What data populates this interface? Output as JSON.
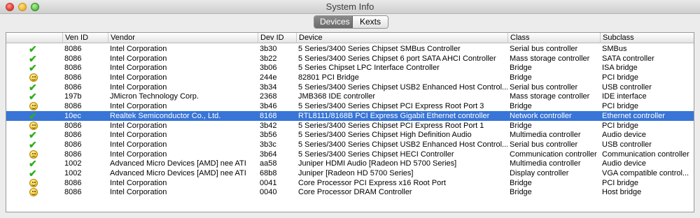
{
  "window": {
    "title": "System Info"
  },
  "tabs": [
    {
      "label": "Devices",
      "active": true
    },
    {
      "label": "Kexts",
      "active": false
    }
  ],
  "table": {
    "columns": [
      "",
      "Ven ID",
      "Vendor",
      "Dev ID",
      "Device",
      "Class",
      "Subclass"
    ],
    "rows": [
      {
        "status": "ok",
        "ven_id": "8086",
        "vendor": "Intel Corporation",
        "dev_id": "3b30",
        "device": "5 Series/3400 Series Chipset SMBus Controller",
        "class": "Serial bus controller",
        "subclass": "SMBus"
      },
      {
        "status": "ok",
        "ven_id": "8086",
        "vendor": "Intel Corporation",
        "dev_id": "3b22",
        "device": "5 Series/3400 Series Chipset 6 port SATA AHCI Controller",
        "class": "Mass storage controller",
        "subclass": "SATA controller"
      },
      {
        "status": "ok",
        "ven_id": "8086",
        "vendor": "Intel Corporation",
        "dev_id": "3b06",
        "device": "5 Series Chipset LPC Interface Controller",
        "class": "Bridge",
        "subclass": "ISA bridge"
      },
      {
        "status": "neutral",
        "ven_id": "8086",
        "vendor": "Intel Corporation",
        "dev_id": "244e",
        "device": "82801 PCI Bridge",
        "class": "Bridge",
        "subclass": "PCI bridge"
      },
      {
        "status": "ok",
        "ven_id": "8086",
        "vendor": "Intel Corporation",
        "dev_id": "3b34",
        "device": "5 Series/3400 Series Chipset USB2 Enhanced Host Control...",
        "class": "Serial bus controller",
        "subclass": "USB controller"
      },
      {
        "status": "ok",
        "ven_id": "197b",
        "vendor": "JMicron Technology Corp.",
        "dev_id": "2368",
        "device": "JMB368 IDE controller",
        "class": "Mass storage controller",
        "subclass": "IDE interface"
      },
      {
        "status": "neutral",
        "ven_id": "8086",
        "vendor": "Intel Corporation",
        "dev_id": "3b46",
        "device": "5 Series/3400 Series Chipset PCI Express Root Port 3",
        "class": "Bridge",
        "subclass": "PCI bridge"
      },
      {
        "status": "ok",
        "ven_id": "10ec",
        "vendor": "Realtek Semiconductor Co., Ltd.",
        "dev_id": "8168",
        "device": "RTL8111/8168B PCI Express Gigabit Ethernet controller",
        "class": "Network controller",
        "subclass": "Ethernet controller",
        "selected": true
      },
      {
        "status": "neutral",
        "ven_id": "8086",
        "vendor": "Intel Corporation",
        "dev_id": "3b42",
        "device": "5 Series/3400 Series Chipset PCI Express Root Port 1",
        "class": "Bridge",
        "subclass": "PCI bridge"
      },
      {
        "status": "ok",
        "ven_id": "8086",
        "vendor": "Intel Corporation",
        "dev_id": "3b56",
        "device": "5 Series/3400 Series Chipset High Definition Audio",
        "class": "Multimedia controller",
        "subclass": "Audio device"
      },
      {
        "status": "ok",
        "ven_id": "8086",
        "vendor": "Intel Corporation",
        "dev_id": "3b3c",
        "device": "5 Series/3400 Series Chipset USB2 Enhanced Host Control...",
        "class": "Serial bus controller",
        "subclass": "USB controller"
      },
      {
        "status": "sad",
        "ven_id": "8086",
        "vendor": "Intel Corporation",
        "dev_id": "3b64",
        "device": "5 Series/3400 Series Chipset HECI Controller",
        "class": "Communication controller",
        "subclass": "Communication controller"
      },
      {
        "status": "ok",
        "ven_id": "1002",
        "vendor": "Advanced Micro Devices [AMD] nee ATI",
        "dev_id": "aa58",
        "device": "Juniper HDMI Audio [Radeon HD 5700 Series]",
        "class": "Multimedia controller",
        "subclass": "Audio device"
      },
      {
        "status": "ok",
        "ven_id": "1002",
        "vendor": "Advanced Micro Devices [AMD] nee ATI",
        "dev_id": "68b8",
        "device": "Juniper [Radeon HD 5700 Series]",
        "class": "Display controller",
        "subclass": "VGA compatible control..."
      },
      {
        "status": "neutral",
        "ven_id": "8086",
        "vendor": "Intel Corporation",
        "dev_id": "0041",
        "device": "Core Processor PCI Express x16 Root Port",
        "class": "Bridge",
        "subclass": "PCI bridge"
      },
      {
        "status": "neutral",
        "ven_id": "8086",
        "vendor": "Intel Corporation",
        "dev_id": "0040",
        "device": "Core Processor DRAM Controller",
        "class": "Bridge",
        "subclass": "Host bridge"
      }
    ]
  }
}
